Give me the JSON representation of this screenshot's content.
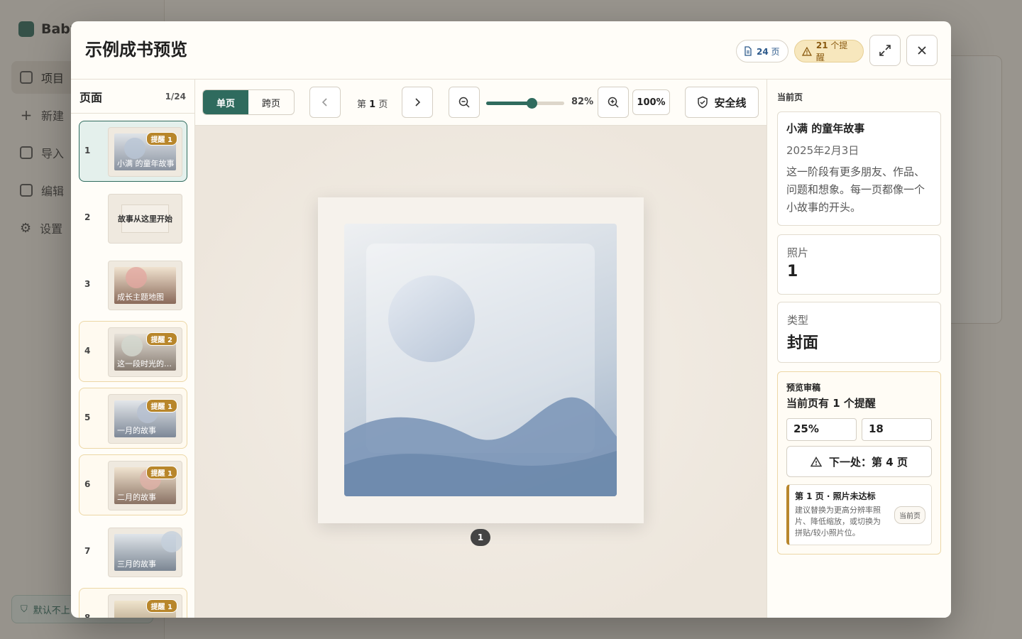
{
  "background": {
    "brand": "Baby",
    "nav": [
      "项目",
      "新建",
      "导入",
      "编辑",
      "设置"
    ],
    "footer": "默认不上"
  },
  "modal": {
    "title": "示例成书预览",
    "pages_count": "24",
    "pages_unit": "页",
    "warn_count": "21",
    "warn_unit": "个提醒",
    "icons": {
      "expand": "expand-icon",
      "close": "close-icon"
    }
  },
  "pages_panel": {
    "title": "页面",
    "counter": "1/24",
    "items": [
      {
        "num": "1",
        "caption": "小满 的童年故事",
        "badge": "提醒 1"
      },
      {
        "num": "2",
        "caption": "故事从这里开始",
        "badge": ""
      },
      {
        "num": "3",
        "caption": "成长主题地图",
        "badge": ""
      },
      {
        "num": "4",
        "caption": "这一段时光的故事",
        "badge": "提醒 2"
      },
      {
        "num": "5",
        "caption": "一月的故事",
        "badge": "提醒 1"
      },
      {
        "num": "6",
        "caption": "二月的故事",
        "badge": "提醒 1"
      },
      {
        "num": "7",
        "caption": "三月的故事",
        "badge": ""
      },
      {
        "num": "8",
        "caption": "",
        "badge": "提醒 1"
      }
    ]
  },
  "toolbar": {
    "mode_single": "单页",
    "mode_spread": "跨页",
    "page_prefix": "第",
    "page_num": "1",
    "page_suffix": "页",
    "zoom": "82%",
    "zoom_level": 0.58,
    "reset_zoom": "100%",
    "safe_line": "安全线"
  },
  "canvas": {
    "page_bubble": "1"
  },
  "right_panel": {
    "section_label": "当前页",
    "title": "小满 的童年故事",
    "date": "2025年2月3日",
    "desc": "这一阶段有更多朋友、作品、问题和想象。每一页都像一个小故事的开头。",
    "photos_label": "照片",
    "photos_value": "1",
    "type_label": "类型",
    "type_value": "封面",
    "review": {
      "label": "预览审稿",
      "summary_prefix": "当前页有",
      "summary_count": "1",
      "summary_suffix": "个提醒",
      "input_a": "25%",
      "input_b": "18",
      "next_prefix": "下一处：第",
      "next_page": "4",
      "next_suffix": "页",
      "issue_title": "第 1 页 · 照片未达标",
      "issue_desc": "建议替换为更高分辨率照片、降低缩放，或切换为拼贴/较小照片位。",
      "issue_tag": "当前页"
    }
  }
}
